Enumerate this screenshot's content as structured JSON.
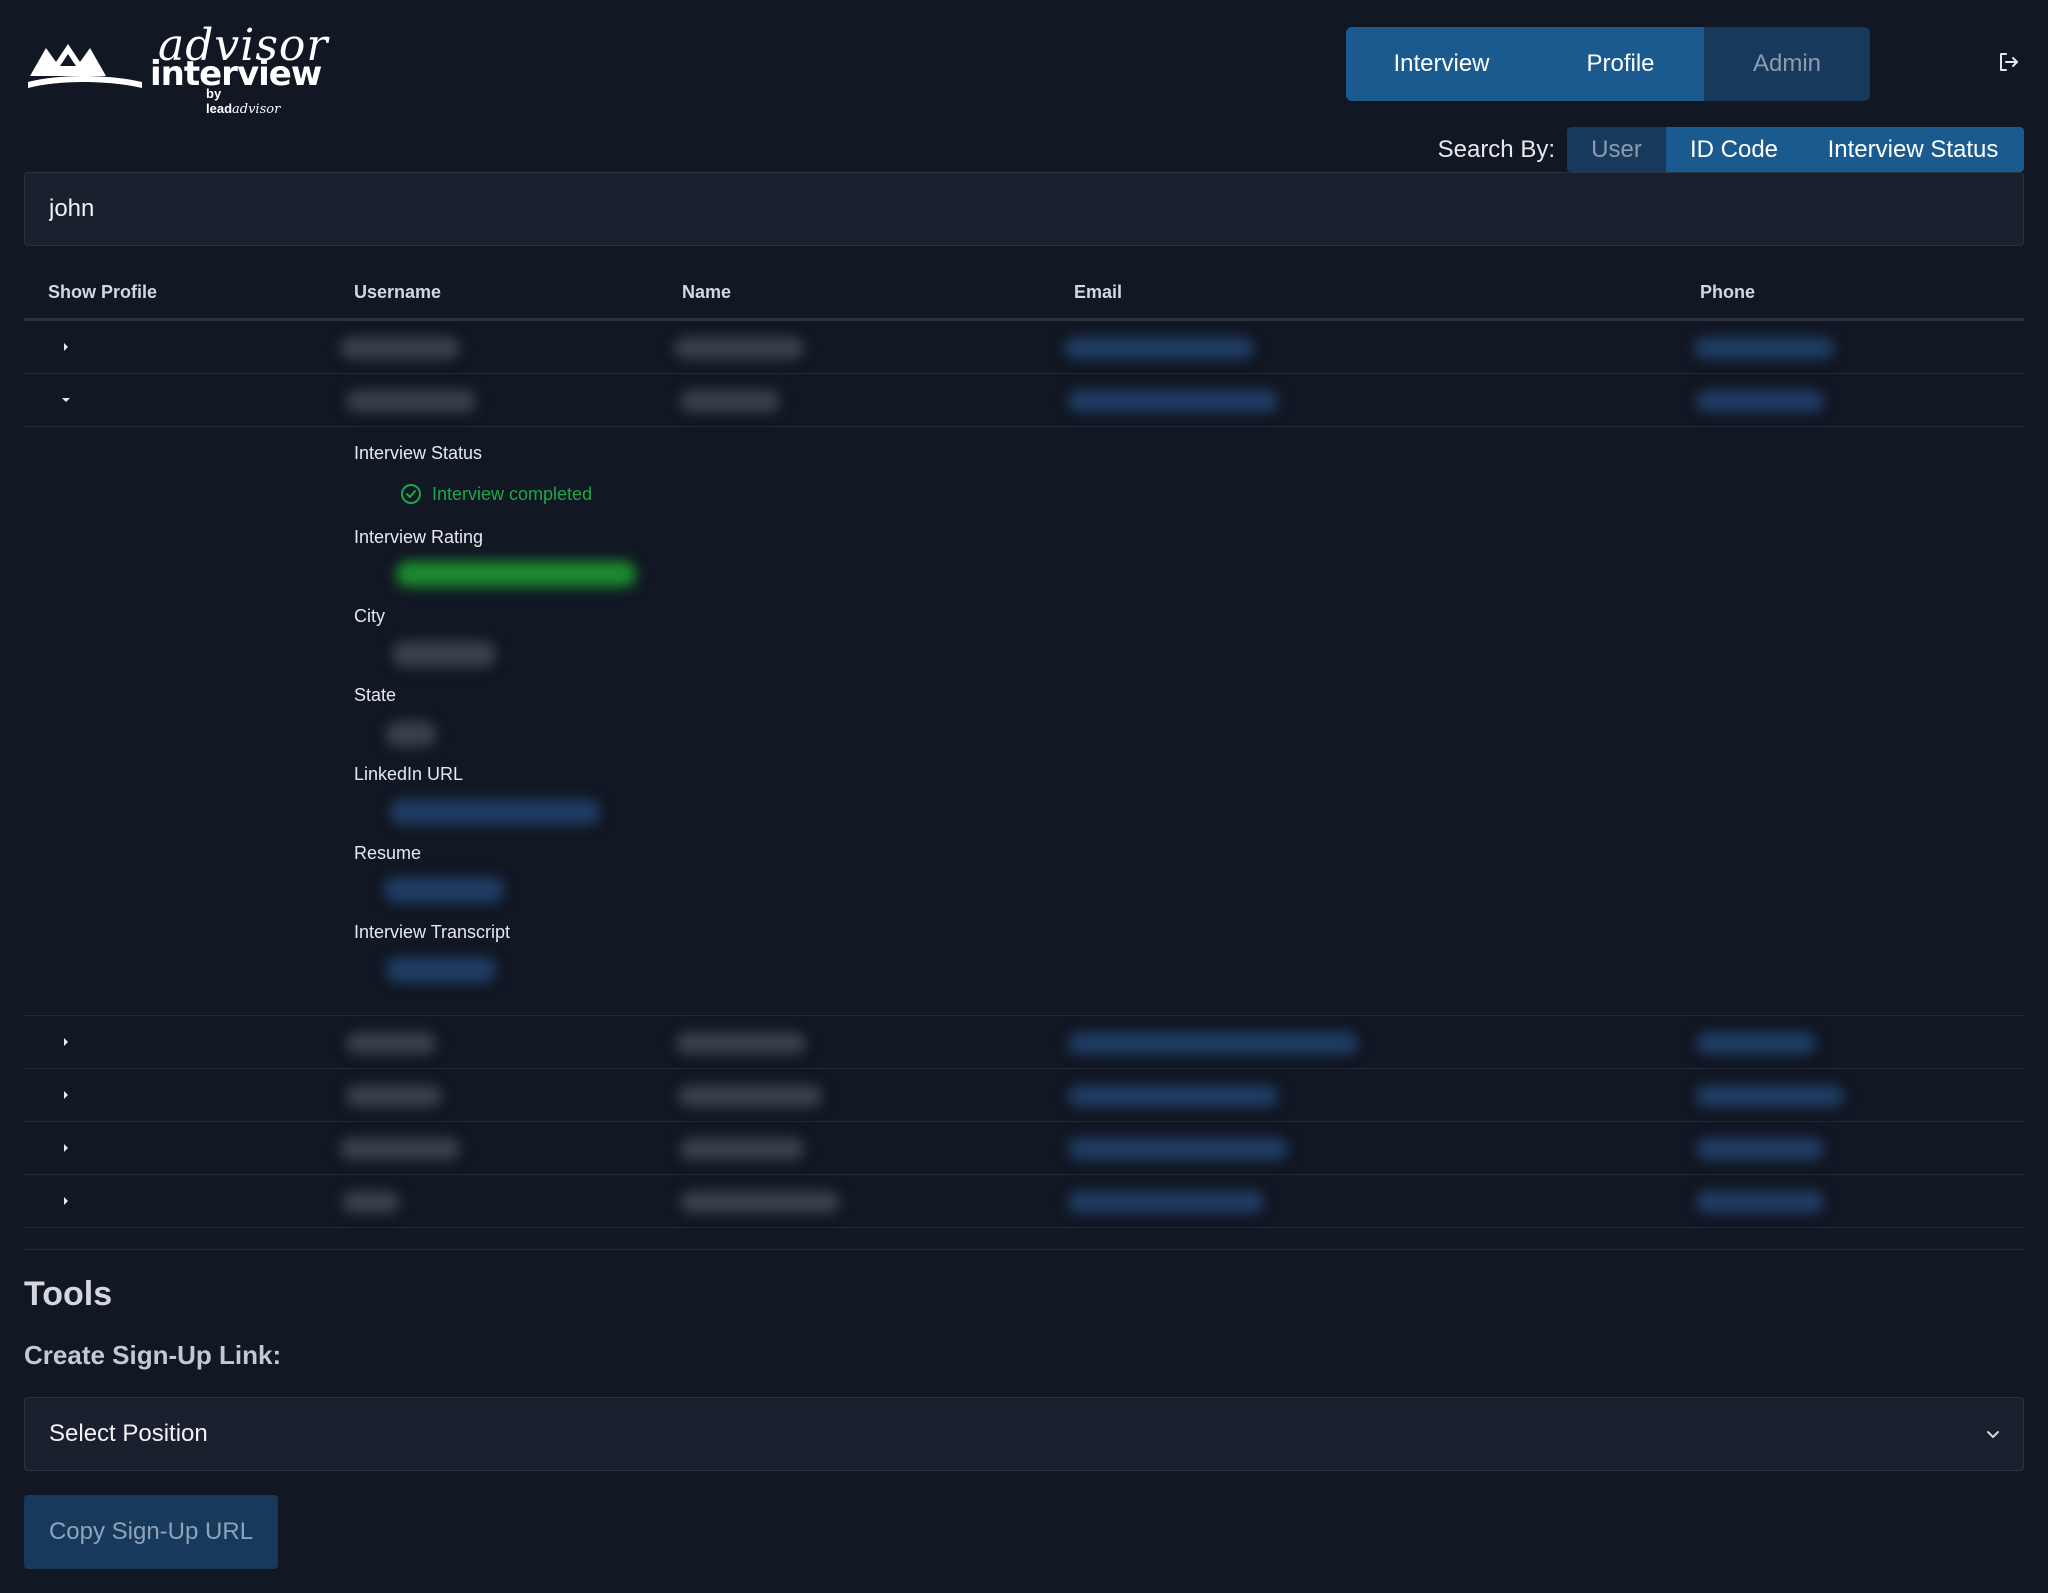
{
  "logo": {
    "advisor": "advisor",
    "interview": "interview",
    "by": "by",
    "lead": "lead",
    "advisor_small": "advisor"
  },
  "nav": {
    "interview": "Interview",
    "profile": "Profile",
    "admin": "Admin"
  },
  "search_by": {
    "label": "Search By:",
    "options": [
      "User",
      "ID Code",
      "Interview Status"
    ]
  },
  "search": {
    "value": "john"
  },
  "table": {
    "headers": [
      "Show Profile",
      "Username",
      "Name",
      "Email",
      "Phone"
    ]
  },
  "profile_detail": {
    "interview_status_label": "Interview Status",
    "interview_status_value": "Interview completed",
    "interview_rating_label": "Interview Rating",
    "city_label": "City",
    "state_label": "State",
    "linkedin_label": "LinkedIn URL",
    "resume_label": "Resume",
    "transcript_label": "Interview Transcript"
  },
  "tools": {
    "title": "Tools",
    "create_label": "Create Sign-Up Link:",
    "select_placeholder": "Select Position",
    "copy_button": "Copy Sign-Up URL"
  },
  "colors": {
    "background": "#111723",
    "accent": "#1a5a8e",
    "accent_muted": "#173a5c",
    "success": "#1ba84a"
  }
}
